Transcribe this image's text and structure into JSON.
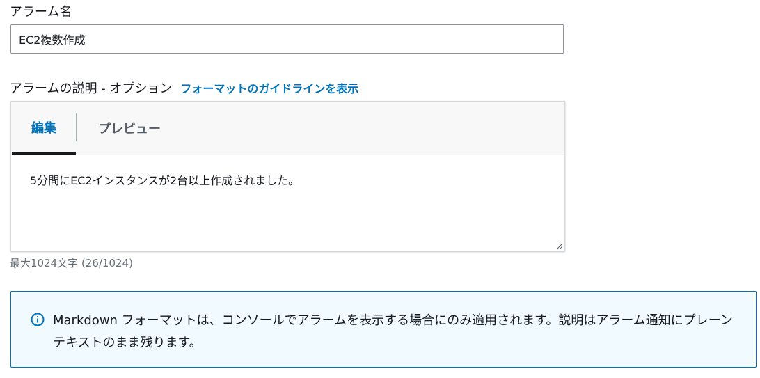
{
  "alarm_name": {
    "label": "アラーム名",
    "value": "EC2複数作成"
  },
  "description": {
    "label": "アラームの説明 - オプション",
    "format_link": "フォーマットのガイドラインを表示",
    "tabs": [
      {
        "label": "編集",
        "selected": true
      },
      {
        "label": "プレビュー",
        "selected": false
      }
    ],
    "value": "5分間にEC2インスタンスが2台以上作成されました。",
    "char_count": "最大1024文字 (26/1024)"
  },
  "info": {
    "icon": "info-icon",
    "text": "Markdown フォーマットは、コンソールでアラームを表示する場合にのみ適用されます。説明はアラーム通知にプレーンテキストのまま残ります。"
  },
  "colors": {
    "link": "#0073bb",
    "info_border": "#0073bb",
    "info_background": "#f1faff"
  }
}
